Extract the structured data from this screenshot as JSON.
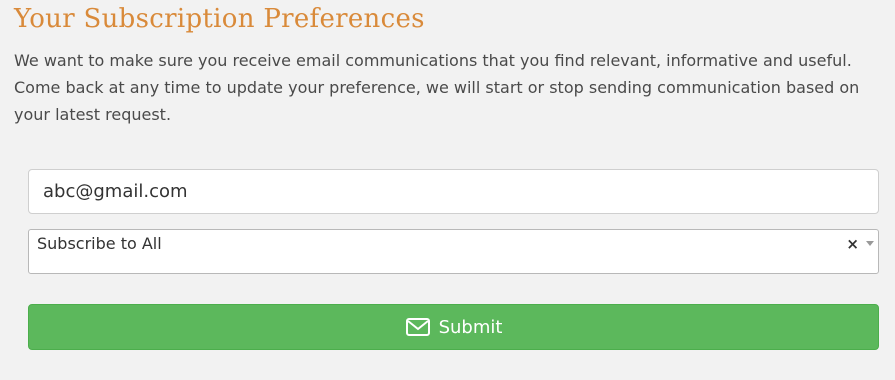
{
  "header": {
    "title": "Your Subscription Preferences",
    "intro": "We want to make sure you receive email communications that you find relevant, informative and useful. Come back at any time to update your preference, we will start or stop sending communication based on your latest request."
  },
  "form": {
    "email_value": "abc@gmail.com",
    "subscription_select": {
      "selected": "Subscribe to All",
      "clear_symbol": "×"
    },
    "submit_label": "Submit",
    "submit_icon": "envelope-icon"
  },
  "colors": {
    "title": "#d98a3a",
    "submit_background": "#5cb85c",
    "page_background": "#f2f2f2"
  }
}
